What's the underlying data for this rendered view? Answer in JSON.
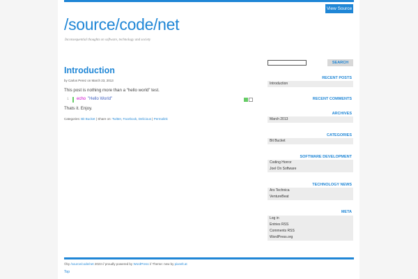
{
  "header": {
    "view_source": "View Source",
    "site_title": "/source/code/net",
    "tagline": "Inconsequential thoughts on software, technology and society"
  },
  "post": {
    "title": "Introduction",
    "meta": "by Carlos Perez on March 23, 2013",
    "paragraph1": "This post is nothing more than a “hello world” test.",
    "code": {
      "line_number": "1",
      "keyword": "echo",
      "string": "\"Hello World\""
    },
    "paragraph2": "Thats it. Enjoy.",
    "footer": {
      "categories_label": "Categories:",
      "category": "Bit Bucket",
      "share_label": "| Share on:",
      "twitter": "Twitter",
      "facebook": "Facebook",
      "delicious": "Delicious",
      "sep": "|",
      "permalink": "Permalink"
    }
  },
  "sidebar": {
    "search_button": "SEARCH",
    "search_placeholder": "",
    "recent_posts": {
      "title": "RECENT POSTS",
      "items": [
        "Introduction"
      ]
    },
    "recent_comments": {
      "title": "RECENT COMMENTS"
    },
    "archives": {
      "title": "ARCHIVES",
      "items": [
        "March 2013"
      ]
    },
    "categories": {
      "title": "CATEGORIES",
      "items": [
        "Bit Bucket"
      ]
    },
    "software_dev": {
      "title": "SOFTWARE DEVELOPMENT",
      "items": [
        "Coding Horror",
        "Joel On Software"
      ]
    },
    "tech_news": {
      "title": "TECHNOLOGY NEWS",
      "items": [
        "Ars Technica",
        "VentureBeat"
      ]
    },
    "meta": {
      "title": "META",
      "items": [
        "Log in",
        "Entries RSS",
        "Comments RSS",
        "WordPress.org"
      ]
    }
  },
  "footer": {
    "prefix": "©by",
    "site_link": "/source/code/net",
    "middle": "2023 // proudly powered by",
    "wordpress": "WordPress",
    "theme": "// Theme: new by",
    "author": "pixeelt.at",
    "top": "Top"
  },
  "colors": {
    "accent": "#1f86d6",
    "widget_bg": "#ececec"
  }
}
